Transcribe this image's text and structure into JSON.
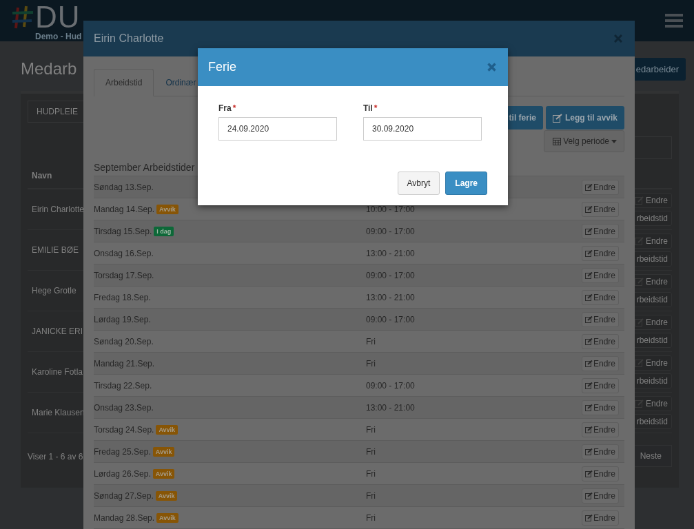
{
  "app_header": {
    "logo_text": "DU",
    "subtitle": "Demo - Hud"
  },
  "page": {
    "title": "Medarb",
    "add_button": "edarbeider",
    "department_select": "HUDPLEIE",
    "table": {
      "columns": [
        "Navn"
      ],
      "rows": [
        {
          "name": "Eirin Charlotte",
          "actions": [
            "Endre",
            "rbeidstid"
          ]
        },
        {
          "name": "EMILIE BØE",
          "actions": [
            "Endre",
            "rbeidstid"
          ]
        },
        {
          "name": "Hege Grotle",
          "actions": [
            "Endre",
            "rbeidstid"
          ]
        },
        {
          "name": "JANICKE ERI",
          "actions": [
            "Endre",
            "rbeidstid"
          ]
        },
        {
          "name": "Karoline Fotla",
          "actions": [
            "Endre",
            "rbeidstid"
          ]
        },
        {
          "name": "Marie Klausen",
          "actions": [
            "Endre",
            "rbeidstid"
          ]
        }
      ]
    },
    "footer_text": "Viser 1 - 6 av 6",
    "next_button": "Neste"
  },
  "employee_modal": {
    "title": "Eirin Charlotte",
    "tabs": [
      {
        "label": "Arbeidstid",
        "selected": true
      },
      {
        "label": "Ordinær",
        "selected": false
      }
    ],
    "action_buttons": [
      "til ferie",
      "Legg til avvik"
    ],
    "period_button": "Velg periode",
    "schedule_title": "September Arbeidstider",
    "schedule": [
      {
        "day": "Søndag 13.Sep.",
        "edit": "Endre"
      },
      {
        "day": "Mandag 14.Sep.",
        "badge": {
          "text": "Avvik",
          "kind": "deviation"
        },
        "time": "10:00 - 17:00",
        "edit": "Endre"
      },
      {
        "day": "Tirsdag 15.Sep.",
        "badge": {
          "text": "I dag",
          "kind": "today"
        },
        "time": "09:00 - 17:00",
        "edit": "Endre"
      },
      {
        "day": "Onsdag 16.Sep.",
        "time": "13:00 - 21:00",
        "edit": "Endre"
      },
      {
        "day": "Torsdag 17.Sep.",
        "time": "09:00 - 17:00",
        "edit": "Endre"
      },
      {
        "day": "Fredag 18.Sep.",
        "time": "13:00 - 21:00",
        "edit": "Endre"
      },
      {
        "day": "Lørdag 19.Sep.",
        "time": "09:00 - 17:00",
        "edit": "Endre"
      },
      {
        "day": "Søndag 20.Sep.",
        "time": "Fri",
        "edit": "Endre"
      },
      {
        "day": "Mandag 21.Sep.",
        "time": "Fri",
        "edit": "Endre"
      },
      {
        "day": "Tirsdag 22.Sep.",
        "time": "09:00 - 17:00",
        "edit": "Endre"
      },
      {
        "day": "Onsdag 23.Sep.",
        "time": "13:00 - 21:00",
        "edit": "Endre"
      },
      {
        "day": "Torsdag 24.Sep.",
        "badge": {
          "text": "Avvik",
          "kind": "deviation"
        },
        "time": "Fri",
        "edit": "Endre"
      },
      {
        "day": "Fredag 25.Sep.",
        "badge": {
          "text": "Avvik",
          "kind": "deviation"
        },
        "time": "Fri",
        "edit": "Endre"
      },
      {
        "day": "Lørdag 26.Sep.",
        "badge": {
          "text": "Avvik",
          "kind": "deviation"
        },
        "time": "Fri",
        "edit": "Endre"
      },
      {
        "day": "Søndag 27.Sep.",
        "badge": {
          "text": "Avvik",
          "kind": "deviation"
        },
        "time": "Fri",
        "edit": "Endre"
      },
      {
        "day": "Mandag 28.Sep.",
        "badge": {
          "text": "Avvik",
          "kind": "deviation"
        },
        "time": "Fri",
        "edit": "Endre"
      }
    ]
  },
  "vacation_dialog": {
    "title": "Ferie",
    "fields": [
      {
        "label": "Fra",
        "required_mark": "*",
        "value": "24.09.2020"
      },
      {
        "label": "Til",
        "required_mark": "*",
        "value": "30.09.2020"
      }
    ],
    "buttons": [
      {
        "label": "Avbryt",
        "kind": "secondary"
      },
      {
        "label": "Lagre",
        "kind": "primary"
      }
    ]
  }
}
